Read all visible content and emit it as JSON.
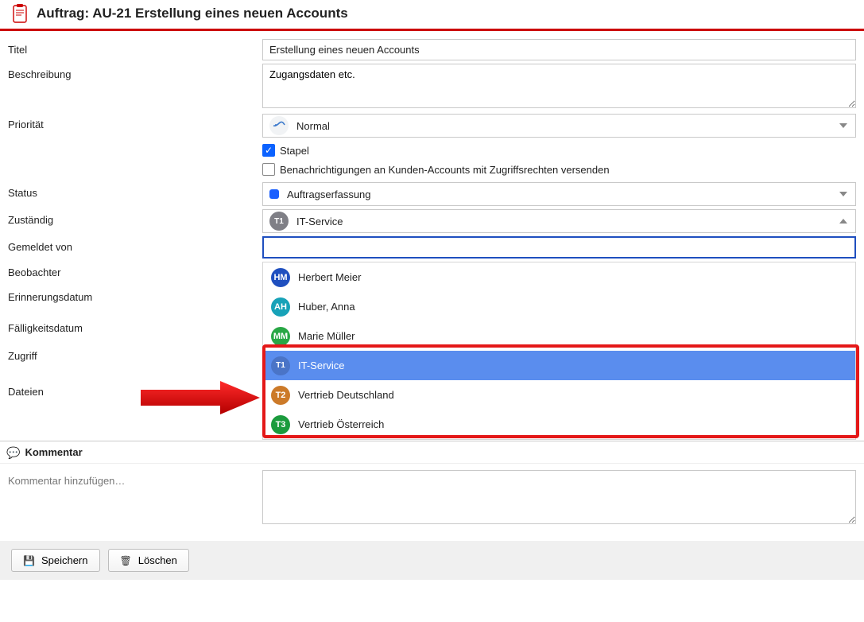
{
  "header": {
    "title": "Auftrag: AU-21 Erstellung eines neuen Accounts"
  },
  "labels": {
    "titel": "Titel",
    "beschreibung": "Beschreibung",
    "prioritaet": "Priorität",
    "status": "Status",
    "zustaendig": "Zuständig",
    "gemeldet_von": "Gemeldet von",
    "beobachter": "Beobachter",
    "erinnerungsdatum": "Erinnerungsdatum",
    "faelligkeitsdatum": "Fälligkeitsdatum",
    "zugriff": "Zugriff",
    "dateien": "Dateien"
  },
  "fields": {
    "titel_value": "Erstellung eines neuen Accounts",
    "beschreibung_value": "Zugangsdaten etc.",
    "prioritaet_value": "Normal",
    "checkbox_stapel": "Stapel",
    "checkbox_notify": "Benachrichtigungen an Kunden-Accounts mit Zugriffsrechten versenden",
    "status_value": "Auftragserfassung",
    "zustaendig_value": "IT-Service",
    "zustaendig_badge": "T1"
  },
  "dropdown": {
    "items": [
      {
        "badge": "HM",
        "color": "av-blue",
        "label": "Herbert Meier"
      },
      {
        "badge": "AH",
        "color": "av-teal",
        "label": "Huber, Anna"
      },
      {
        "badge": "MM",
        "color": "av-green",
        "label": "Marie Müller"
      },
      {
        "badge": "T1",
        "color": "av-grey",
        "label": "IT-Service",
        "highlight": true
      },
      {
        "badge": "T2",
        "color": "av-orange",
        "label": "Vertrieb Deutschland"
      },
      {
        "badge": "T3",
        "color": "av-dgreen",
        "label": "Vertrieb Österreich"
      }
    ]
  },
  "kommentar": {
    "section_title": "Kommentar",
    "hint": "Kommentar hinzufügen…"
  },
  "footer": {
    "save": "Speichern",
    "delete": "Löschen"
  }
}
